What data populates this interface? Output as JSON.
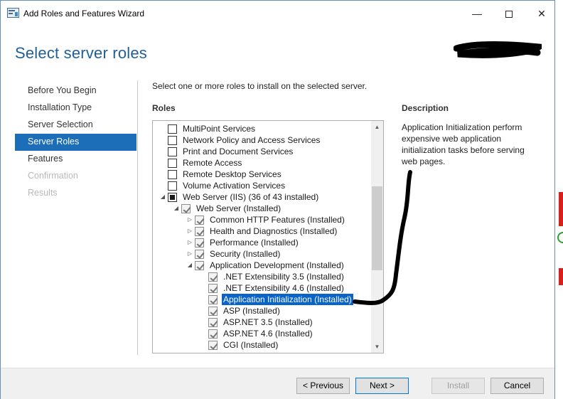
{
  "window": {
    "title": "Add Roles and Features Wizard",
    "minimize_glyph": "—",
    "close_glyph": "✕"
  },
  "page": {
    "title": "Select server roles"
  },
  "nav": {
    "items": [
      {
        "label": "Before You Begin",
        "state": "normal"
      },
      {
        "label": "Installation Type",
        "state": "normal"
      },
      {
        "label": "Server Selection",
        "state": "normal"
      },
      {
        "label": "Server Roles",
        "state": "selected"
      },
      {
        "label": "Features",
        "state": "normal"
      },
      {
        "label": "Confirmation",
        "state": "disabled"
      },
      {
        "label": "Results",
        "state": "disabled"
      }
    ]
  },
  "main": {
    "intro": "Select one or more roles to install on the selected server.",
    "roles_heading": "Roles",
    "description_heading": "Description",
    "description_text": "Application Initialization perform expensive web application initialization tasks before serving web pages."
  },
  "tree": {
    "items": [
      {
        "label": "MultiPoint Services",
        "level": 0,
        "check": "none",
        "expander": "none"
      },
      {
        "label": "Network Policy and Access Services",
        "level": 0,
        "check": "none",
        "expander": "none"
      },
      {
        "label": "Print and Document Services",
        "level": 0,
        "check": "none",
        "expander": "none"
      },
      {
        "label": "Remote Access",
        "level": 0,
        "check": "none",
        "expander": "none"
      },
      {
        "label": "Remote Desktop Services",
        "level": 0,
        "check": "none",
        "expander": "none"
      },
      {
        "label": "Volume Activation Services",
        "level": 0,
        "check": "none",
        "expander": "none"
      },
      {
        "label": "Web Server (IIS) (36 of 43 installed)",
        "level": 0,
        "check": "partial",
        "expander": "expanded"
      },
      {
        "label": "Web Server (Installed)",
        "level": 1,
        "check": "checked",
        "expander": "expanded"
      },
      {
        "label": "Common HTTP Features (Installed)",
        "level": 2,
        "check": "checked",
        "expander": "collapsed"
      },
      {
        "label": "Health and Diagnostics (Installed)",
        "level": 2,
        "check": "checked",
        "expander": "collapsed"
      },
      {
        "label": "Performance (Installed)",
        "level": 2,
        "check": "checked",
        "expander": "collapsed"
      },
      {
        "label": "Security (Installed)",
        "level": 2,
        "check": "checked",
        "expander": "collapsed"
      },
      {
        "label": "Application Development (Installed)",
        "level": 2,
        "check": "checked",
        "expander": "expanded"
      },
      {
        "label": ".NET Extensibility 3.5 (Installed)",
        "level": 3,
        "check": "checked",
        "expander": "none"
      },
      {
        "label": ".NET Extensibility 4.6 (Installed)",
        "level": 3,
        "check": "checked",
        "expander": "none"
      },
      {
        "label": "Application Initialization (Installed)",
        "level": 3,
        "check": "checked",
        "expander": "none",
        "selected": true
      },
      {
        "label": "ASP (Installed)",
        "level": 3,
        "check": "checked",
        "expander": "none"
      },
      {
        "label": "ASP.NET 3.5 (Installed)",
        "level": 3,
        "check": "checked",
        "expander": "none"
      },
      {
        "label": "ASP.NET 4.6 (Installed)",
        "level": 3,
        "check": "checked",
        "expander": "none"
      },
      {
        "label": "CGI (Installed)",
        "level": 3,
        "check": "checked",
        "expander": "none"
      }
    ]
  },
  "footer": {
    "previous_label": "< Previous",
    "next_label": "Next >",
    "install_label": "Install",
    "cancel_label": "Cancel"
  },
  "colors": {
    "accent": "#1c6eb9",
    "title": "#1f5e97",
    "selection": "#0a64c8"
  }
}
